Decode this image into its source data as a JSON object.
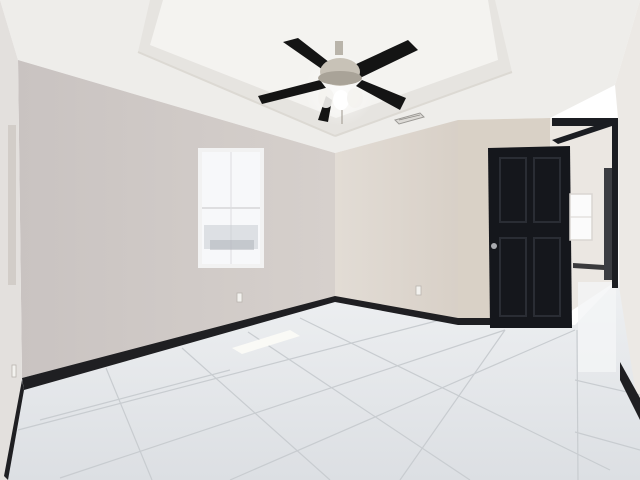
{
  "scene": {
    "description_visible_text": "",
    "colors": {
      "ceiling": "#eeedea",
      "ceiling_tray": "#f3f2ef",
      "left_wall": "#cfc9c6",
      "back_wall": "#ddd6cf",
      "right_wall_section": "#d9d0c4",
      "far_right_wall": "#e9e6e2",
      "baseboard": "#1c1c1e",
      "floor": "#e4e7ea",
      "floor_grout": "#c4c8cc",
      "door": "#15171c",
      "door_frame": "#1b1d22",
      "fan_blade": "#141414",
      "fan_metal": "#b9b4aa",
      "window_glass": "#f7f8fa",
      "window_frame": "#f2f2f2",
      "sunlight": "#f6f6f2"
    },
    "icons": {
      "ceiling_fan": "ceiling-fan-icon",
      "door": "door-icon",
      "window": "window-icon",
      "air_vent": "air-vent-icon",
      "outlet": "power-outlet-icon"
    }
  }
}
